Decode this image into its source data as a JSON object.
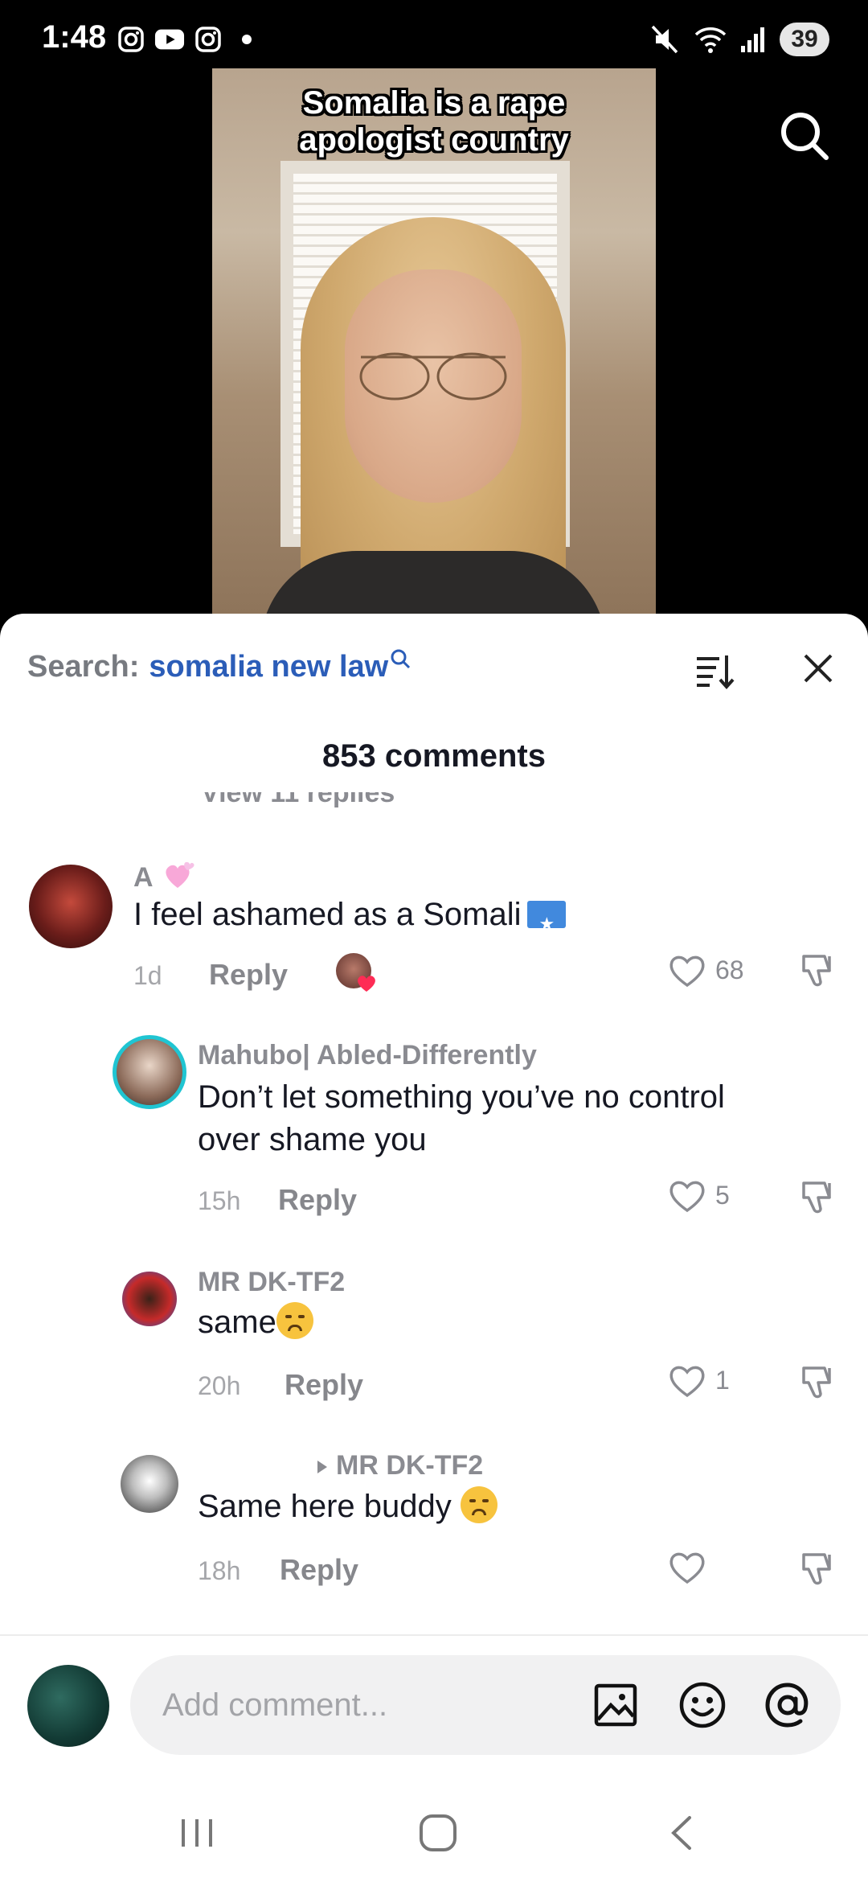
{
  "status_bar": {
    "time": "1:48",
    "battery": "39",
    "icons": [
      "instagram-icon",
      "youtube-icon",
      "instagram-icon",
      "dot-icon",
      "mute-icon",
      "wifi-icon",
      "signal-icon",
      "battery-icon"
    ]
  },
  "video": {
    "caption_line1": "Somalia is a rape",
    "caption_line2": "apologist country"
  },
  "comments_sheet": {
    "search_label": "Search:",
    "search_query": "somalia new law",
    "count_label": "853 comments",
    "partial_text": "View 11 replies",
    "comments": [
      {
        "username": "A",
        "text": "I feel ashamed as a Somali",
        "time": "1d",
        "reply": "Reply",
        "likes": "68"
      },
      {
        "username": "Mahubo| Abled-Differently",
        "text_line1": "Don’t let something you’ve no control",
        "text_line2": "over shame you",
        "time": "15h",
        "reply": "Reply",
        "likes": "5"
      },
      {
        "username": "MR DK-TF2",
        "text": "same",
        "time": "20h",
        "reply": "Reply",
        "likes": "1"
      },
      {
        "reply_to": "MR DK-TF2",
        "text": "Same here buddy",
        "time": "18h",
        "reply": "Reply",
        "likes": ""
      }
    ]
  },
  "input": {
    "placeholder": "Add comment..."
  },
  "colors": {
    "link_blue": "#2b5db8",
    "muted_gray": "#8a8b91",
    "like_red": "#fe2c55"
  }
}
